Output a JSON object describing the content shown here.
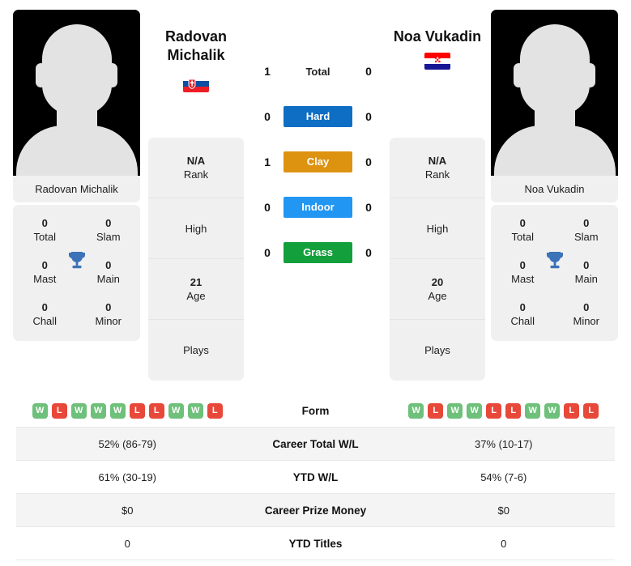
{
  "players": {
    "left": {
      "first_name": "Radovan",
      "last_name": "Michalik",
      "full_name": "Radovan Michalik",
      "country": "Slovakia",
      "flag_icon": "flag-slovakia-icon",
      "avatar_icon": "player-silhouette-icon",
      "rank": "N/A",
      "rank_label": "Rank",
      "high_label": "High",
      "high_value": "",
      "age": "21",
      "age_label": "Age",
      "plays_label": "Plays",
      "plays_value": "",
      "titles": {
        "total": "0",
        "total_label": "Total",
        "slam": "0",
        "slam_label": "Slam",
        "mast": "0",
        "mast_label": "Mast",
        "main": "0",
        "main_label": "Main",
        "chall": "0",
        "chall_label": "Chall",
        "minor": "0",
        "minor_label": "Minor"
      },
      "form": [
        "W",
        "L",
        "W",
        "W",
        "W",
        "L",
        "L",
        "W",
        "W",
        "L"
      ],
      "career_total_wl": "52% (86-79)",
      "ytd_wl": "61% (30-19)",
      "career_prize_money": "$0",
      "ytd_titles": "0"
    },
    "right": {
      "first_name": "Noa",
      "last_name": "Vukadin",
      "full_name": "Noa Vukadin",
      "country": "Croatia",
      "flag_icon": "flag-croatia-icon",
      "avatar_icon": "player-silhouette-icon",
      "rank": "N/A",
      "rank_label": "Rank",
      "high_label": "High",
      "high_value": "",
      "age": "20",
      "age_label": "Age",
      "plays_label": "Plays",
      "plays_value": "",
      "titles": {
        "total": "0",
        "total_label": "Total",
        "slam": "0",
        "slam_label": "Slam",
        "mast": "0",
        "mast_label": "Mast",
        "main": "0",
        "main_label": "Main",
        "chall": "0",
        "chall_label": "Chall",
        "minor": "0",
        "minor_label": "Minor"
      },
      "form": [
        "W",
        "L",
        "W",
        "W",
        "L",
        "L",
        "W",
        "W",
        "L",
        "L"
      ],
      "career_total_wl": "37% (10-17)",
      "ytd_wl": "54% (7-6)",
      "career_prize_money": "$0",
      "ytd_titles": "0"
    }
  },
  "head_to_head": [
    {
      "label": "Total",
      "left": "1",
      "right": "0",
      "color": "",
      "style": "plain"
    },
    {
      "label": "Hard",
      "left": "0",
      "right": "0",
      "color": "#0d6ec4",
      "style": "pill"
    },
    {
      "label": "Clay",
      "left": "1",
      "right": "0",
      "color": "#dd9210",
      "style": "pill"
    },
    {
      "label": "Indoor",
      "left": "0",
      "right": "0",
      "color": "#2196f3",
      "style": "pill"
    },
    {
      "label": "Grass",
      "left": "0",
      "right": "0",
      "color": "#13a03c",
      "style": "pill"
    }
  ],
  "comparison_table": [
    {
      "label": "Form",
      "type": "form"
    },
    {
      "label": "Career Total W/L",
      "type": "text",
      "key": "career_total_wl"
    },
    {
      "label": "YTD W/L",
      "type": "text",
      "key": "ytd_wl"
    },
    {
      "label": "Career Prize Money",
      "type": "text",
      "key": "career_prize_money"
    },
    {
      "label": "YTD Titles",
      "type": "text",
      "key": "ytd_titles"
    }
  ],
  "colors": {
    "hard": "#0d6ec4",
    "clay": "#dd9210",
    "indoor": "#2196f3",
    "grass": "#13a03c",
    "win_badge": "#6ec07a",
    "loss_badge": "#e8483a",
    "card_bg": "#f0f0f0",
    "row_alt_bg": "#f4f4f4"
  }
}
